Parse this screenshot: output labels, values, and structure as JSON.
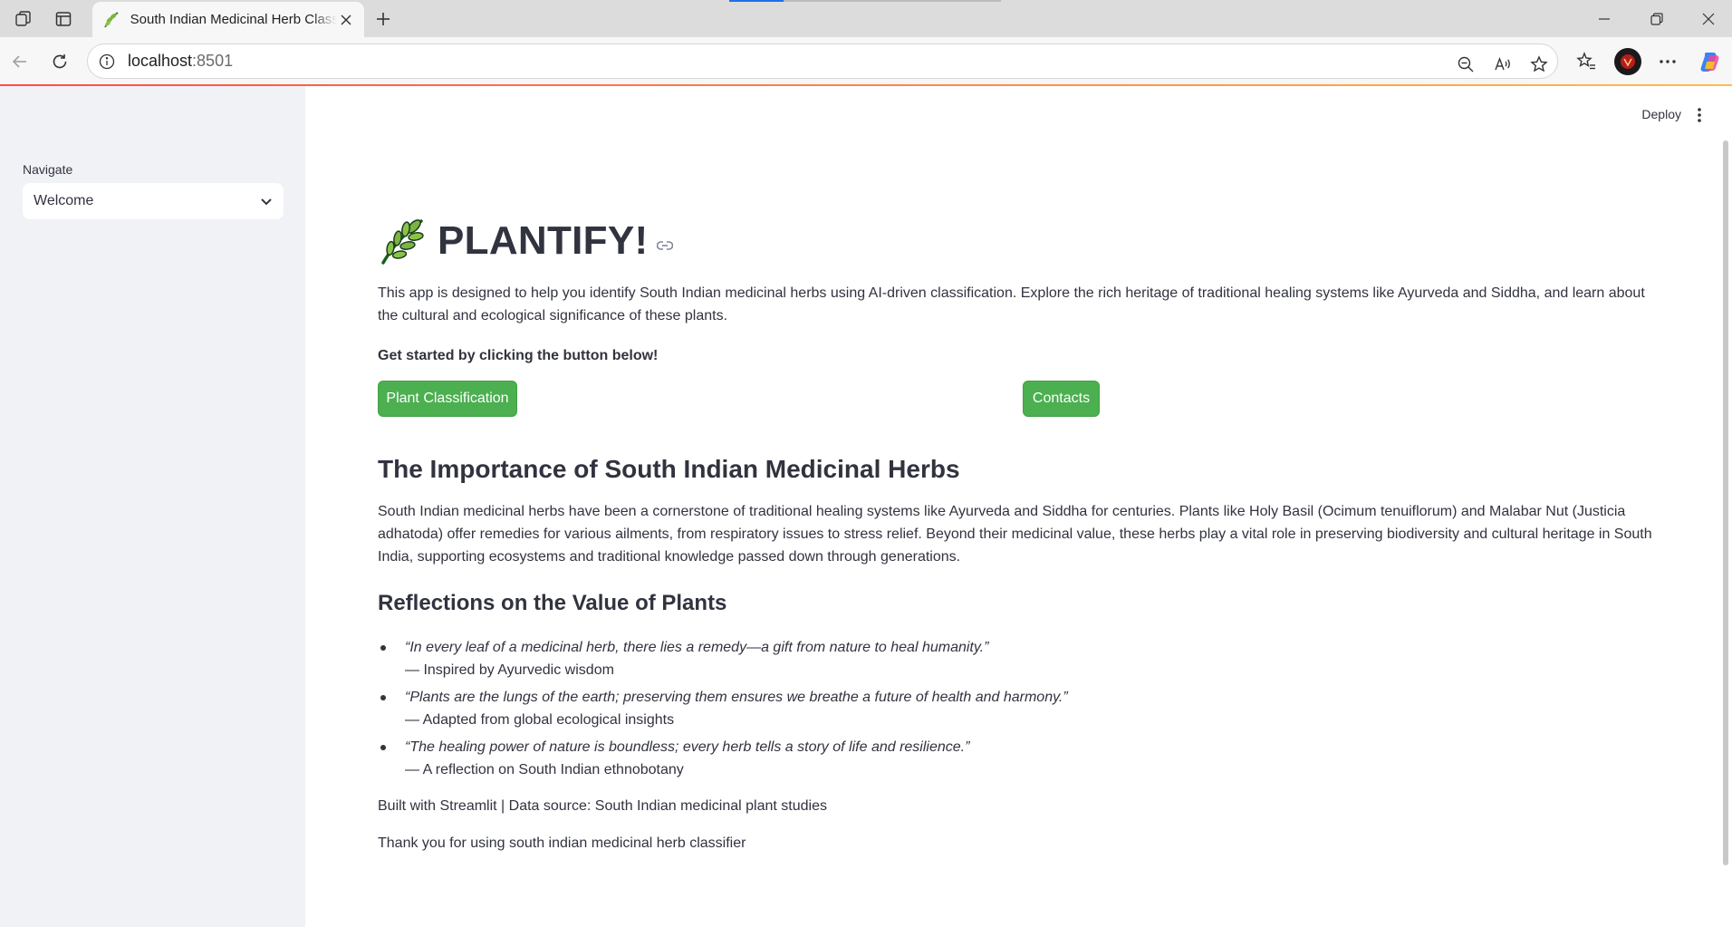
{
  "browser": {
    "tab_title": "South Indian Medicinal Herb Classifier",
    "url_host": "localhost",
    "url_port": ":8501",
    "accent_colors": [
      "#ff4b4b",
      "#ffbd45"
    ]
  },
  "sidebar": {
    "nav_label": "Navigate",
    "select_value": "Welcome"
  },
  "header": {
    "deploy_label": "Deploy"
  },
  "main": {
    "title": "PLANTIFY!",
    "intro": "This app is designed to help you identify South Indian medicinal herbs using AI-driven classification. Explore the rich heritage of traditional healing systems like Ayurveda and Siddha, and learn about the cultural and ecological significance of these plants.",
    "cta": "Get started by clicking the button below!",
    "buttons": {
      "classification": "Plant Classification",
      "contacts": "Contacts",
      "color": "#4caf50"
    },
    "importance_heading": "The Importance of South Indian Medicinal Herbs",
    "importance_text": "South Indian medicinal herbs have been a cornerstone of traditional healing systems like Ayurveda and Siddha for centuries. Plants like Holy Basil (Ocimum tenuiflorum) and Malabar Nut (Justicia adhatoda) offer remedies for various ailments, from respiratory issues to stress relief. Beyond their medicinal value, these herbs play a vital role in preserving biodiversity and cultural heritage in South India, supporting ecosystems and traditional knowledge passed down through generations.",
    "reflections_heading": "Reflections on the Value of Plants",
    "quotes": [
      {
        "text": "“In every leaf of a medicinal herb, there lies a remedy—a gift from nature to heal humanity.”",
        "source": "— Inspired by Ayurvedic wisdom"
      },
      {
        "text": "“Plants are the lungs of the earth; preserving them ensures we breathe a future of health and harmony.”",
        "source": "— Adapted from global ecological insights"
      },
      {
        "text": "“The healing power of nature is boundless; every herb tells a story of life and resilience.”",
        "source": "— A reflection on South Indian ethnobotany"
      }
    ],
    "footer_built": "Built with Streamlit | Data source: South Indian medicinal plant studies",
    "footer_thanks": "Thank you for using south indian medicinal herb classifier"
  }
}
